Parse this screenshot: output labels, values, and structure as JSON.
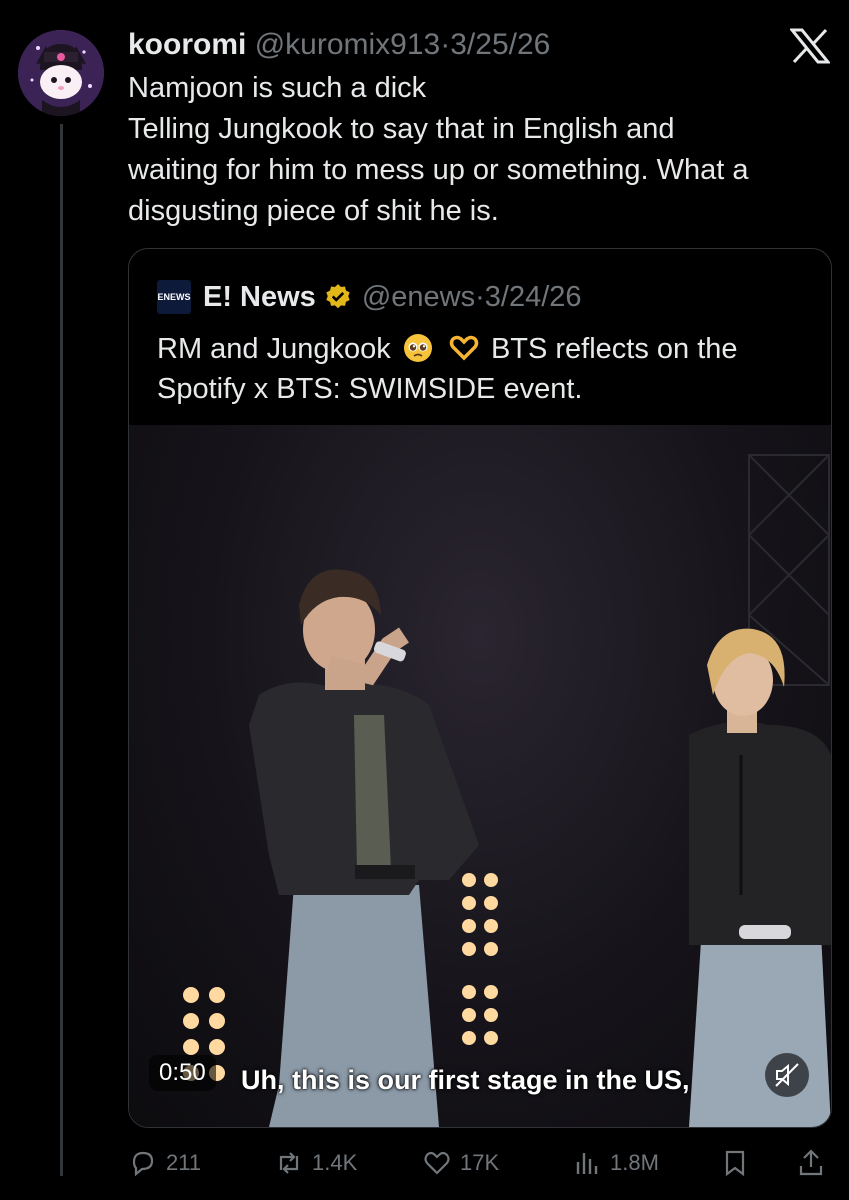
{
  "tweet": {
    "display_name": "kooromi",
    "handle": "@kuromix913",
    "dot": "·",
    "date": "3/25/26",
    "lines": [
      "Namjoon is such a dick",
      "Telling Jungkook to say that in English and",
      "waiting for him to mess up or something. What a",
      "disgusting piece of shit he is."
    ]
  },
  "quote": {
    "logo_text": "ENEWS",
    "display_name": "E! News",
    "handle": "@enews",
    "dot": "·",
    "date": "3/24/26",
    "line1_before": "RM and Jungkook",
    "line1_after": "BTS reflects on the",
    "line2": "Spotify x BTS: SWIMSIDE event.",
    "emojis": [
      "pleading-face",
      "heart-hands"
    ]
  },
  "video": {
    "time": "0:50",
    "subtitle": "Uh, this is our first stage in the US,"
  },
  "actions": {
    "replies": "211",
    "reposts": "1.4K",
    "likes": "17K",
    "views": "1.8M"
  },
  "icons": [
    "x-logo-icon",
    "verified-badge-icon",
    "reply-icon",
    "repost-icon",
    "like-icon",
    "views-icon",
    "bookmark-icon",
    "share-icon",
    "mute-icon"
  ],
  "colors": {
    "background": "#000000",
    "text": "#e7e9ea",
    "muted": "#71767b",
    "border": "#2f3336",
    "verified": "#e2b719"
  }
}
